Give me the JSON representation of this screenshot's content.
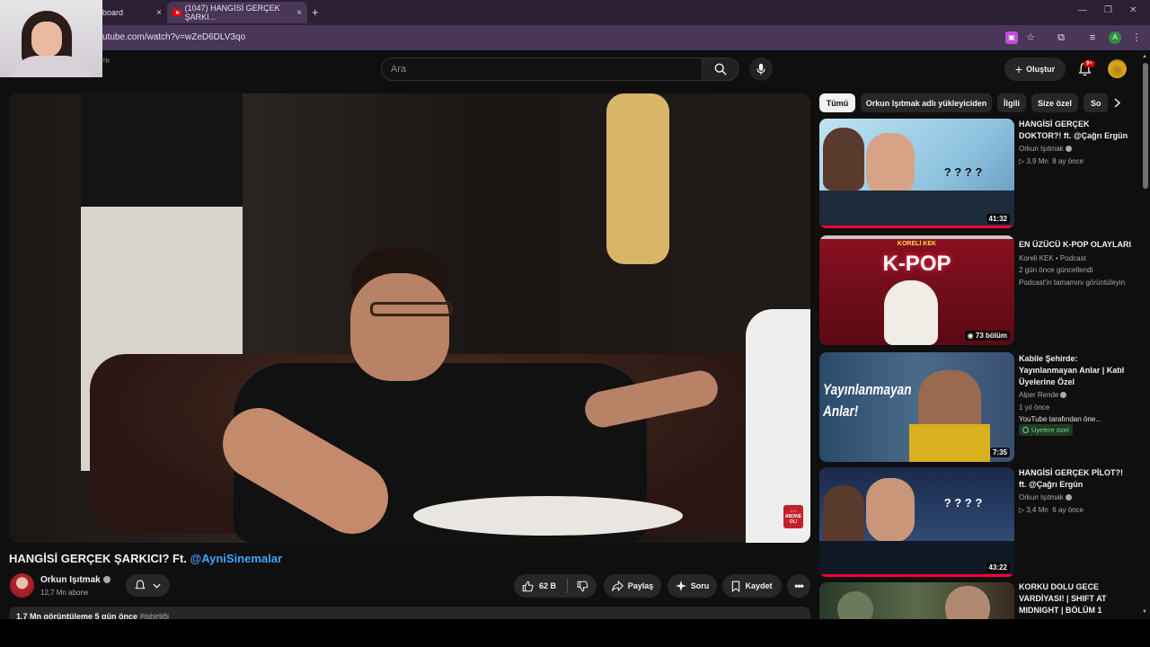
{
  "browser": {
    "tabs": [
      {
        "title": "board"
      },
      {
        "title": "(1047) HANGİSİ GERÇEK ŞARKI..."
      }
    ],
    "new_tab": "+",
    "url": "utube.com/watch?v=wZeD6DLV3qo",
    "profile_initial": "A",
    "tab_close": "×"
  },
  "header": {
    "region_code": "TR",
    "search_placeholder": "Ara",
    "create_label": "Oluştur",
    "notification_count": "9+"
  },
  "video": {
    "title_prefix": "HANGİSİ GERÇEK ŞARKICI? Ft. ",
    "title_mention": "@AyniSinemalar",
    "watermark": "ABONE OL!",
    "channel_name": "Orkun Işıtmak",
    "subscribers": "12,7 Mn abone",
    "likes": "62 B",
    "share_label": "Paylaş",
    "ask_label": "Soru",
    "save_label": "Kaydet",
    "description_meta": "1,7 Mn görüntüleme  5 gün önce  ",
    "description_hashtag": "#işbirliği"
  },
  "chips": [
    "Tümü",
    "Orkun Işıtmak adlı yükleyiciden",
    "İlgili",
    "Size özel",
    "So"
  ],
  "recommendations": [
    {
      "title": "HANGİSİ GERÇEK DOKTOR?! ft. @Çağrı Ergün",
      "channel": "Orkun Işıtmak",
      "views": "3,9 Mn",
      "age": "8 ay önce",
      "duration": "41:32"
    },
    {
      "title": "EN ÜZÜCÜ K-POP OLAYLARI",
      "channel": "Koreli KEK • Podcast",
      "updated": "2 gün önce güncellendi",
      "cta": "Podcast'in tamamını görüntüleyin",
      "episodes": "73 bölüm",
      "thumb_brand": "KORELİ KEK",
      "thumb_text": "K-POP"
    },
    {
      "title": "Kabile Şehirde: Yayınlanmayan Anlar | Katıl Üyelerine Özel",
      "channel": "Alper Rende",
      "age": "1 yıl önce",
      "note": "YouTube tarafından öne...",
      "badge": "Üyelere özel",
      "duration": "7:35",
      "thumb_text": "Yayınlanmayan Anlar!"
    },
    {
      "title": "HANGİSİ GERÇEK PİLOT?! ft. @Çağrı Ergün",
      "channel": "Orkun Işıtmak",
      "views": "3,4 Mn",
      "age": "6 ay önce",
      "duration": "43:22"
    },
    {
      "title": "KORKU DOLU GECE VARDİYASI! | SHIFT AT MIDNIGHT | BÖLÜM 1"
    }
  ],
  "colors": {
    "accent_red": "#ff0033",
    "link_blue": "#3ea6ff",
    "browser_frame": "#4a3658"
  }
}
